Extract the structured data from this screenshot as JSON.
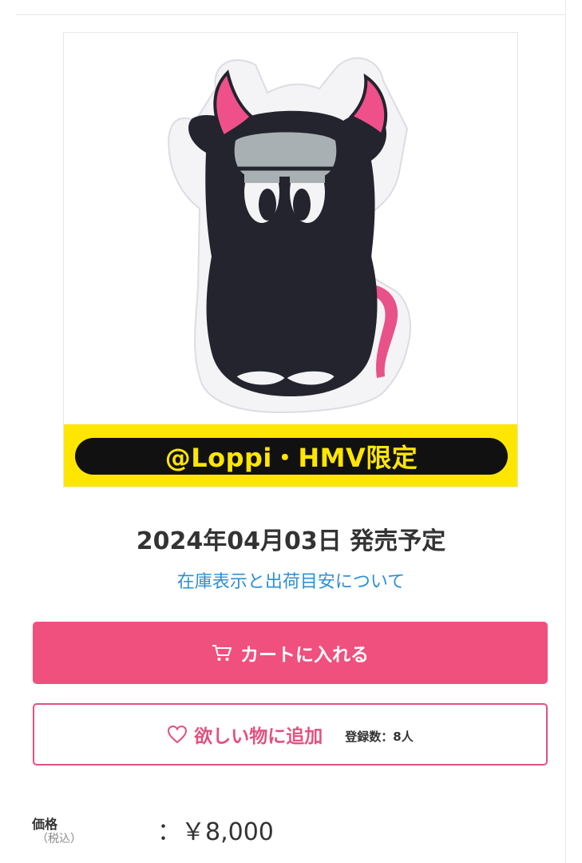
{
  "product": {
    "image_alt": "black cow cushion with pink horns",
    "promo_badge": "@Loppi・HMV限定"
  },
  "release": {
    "date_text": "2024年04月03日 発売予定",
    "stock_info_link": "在庫表示と出荷目安について"
  },
  "actions": {
    "cart_label": "カートに入れる",
    "wishlist_label": "欲しい物に追加",
    "wishlist_count": "登録数：8人"
  },
  "price": {
    "label": "価格",
    "tax_note": "（税込）",
    "value": "：￥8,000"
  },
  "colors": {
    "accent_pink": "#f0507e",
    "link_blue": "#2d8fd6",
    "promo_yellow": "#ffe600",
    "character_body": "#23242e",
    "horn_pink": "#f0508a"
  }
}
